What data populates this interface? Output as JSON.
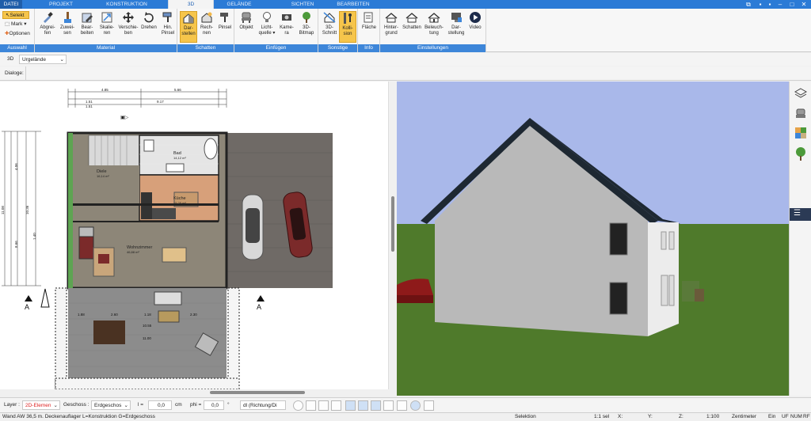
{
  "menu": {
    "tabs": [
      {
        "label": "DATEI"
      },
      {
        "label": "PROJEKT"
      },
      {
        "label": "KONSTRUKTION"
      },
      {
        "label": "3D"
      },
      {
        "label": "GELÄNDE"
      },
      {
        "label": "SICHTEN"
      },
      {
        "label": "BEARBEITEN"
      }
    ]
  },
  "ribbon": {
    "auswahl": {
      "title": "Auswahl",
      "selekt": "Selekt",
      "mark": "Mark",
      "optionen": "Optionen"
    },
    "material": {
      "title": "Material",
      "buttons": [
        {
          "l1": "Abgrei-",
          "l2": "fen"
        },
        {
          "l1": "Zuwei-",
          "l2": "sen"
        },
        {
          "l1": "Bear-",
          "l2": "beiten"
        },
        {
          "l1": "Skalie-",
          "l2": "ren"
        },
        {
          "l1": "Verschie-",
          "l2": "ben"
        },
        {
          "l1": "Drehen",
          "l2": ""
        },
        {
          "l1": "Hin.",
          "l2": "Pinsel"
        }
      ]
    },
    "schatten": {
      "title": "Schatten",
      "buttons": [
        {
          "l1": "Dar-",
          "l2": "stellen"
        },
        {
          "l1": "Rech-",
          "l2": "nen"
        },
        {
          "l1": "Pinsel",
          "l2": ""
        }
      ]
    },
    "einfuegen": {
      "title": "Einfügen",
      "buttons": [
        {
          "l1": "Objekt",
          "l2": ""
        },
        {
          "l1": "Licht-",
          "l2": "quelle ▾"
        },
        {
          "l1": "Kame-",
          "l2": "ra"
        },
        {
          "l1": "3D-",
          "l2": "Bitmap"
        }
      ]
    },
    "sonstige": {
      "title": "Sonstige",
      "buttons": [
        {
          "l1": "3D-",
          "l2": "Schnitt"
        },
        {
          "l1": "Kolli-",
          "l2": "sion"
        }
      ]
    },
    "info": {
      "title": "Info",
      "buttons": [
        {
          "l1": "Fläche",
          "l2": ""
        }
      ]
    },
    "einstellungen": {
      "title": "Einstellungen",
      "buttons": [
        {
          "l1": "Hinter-",
          "l2": "grund"
        },
        {
          "l1": "Schatten",
          "l2": ""
        },
        {
          "l1": "Beleuch-",
          "l2": "tung"
        },
        {
          "l1": "Dar-",
          "l2": "stellung"
        },
        {
          "l1": "Video",
          "l2": ""
        }
      ]
    }
  },
  "viewbar": {
    "mode": "3D",
    "terrain": "Urgelände"
  },
  "dialog": {
    "label": "Dialoge:"
  },
  "plan": {
    "rooms": [
      {
        "name": "Bad",
        "area": "14,12 m²"
      },
      {
        "name": "Diele",
        "area": "16,14 m²"
      },
      {
        "name": "Küche",
        "area": "15,25 m²"
      },
      {
        "name": "Wohnzimmer",
        "area": "46,88 m²"
      }
    ],
    "dims_top": [
      "4.85",
      "5.66",
      "1.51",
      "9.17",
      "1.51"
    ],
    "dims_left": [
      "11.08",
      "10.36",
      "8.66",
      "4.06",
      "1.40"
    ],
    "dims_terrace": [
      "1.88",
      "2.60",
      "1.18",
      "2.30",
      "10.55",
      "11.00"
    ],
    "section_marks": [
      "A",
      "A"
    ]
  },
  "bottombar": {
    "layer_label": "Layer :",
    "layer_value": "2D-Elemen",
    "geschoss_label": "Geschoss :",
    "geschoss_value": "Erdgeschos",
    "l_label": "l =",
    "l_value": "0,0",
    "l_unit": "cm",
    "phi_label": "phi =",
    "phi_value": "0,0",
    "phi_unit": "°",
    "direction": "dl (Richtung/Di"
  },
  "status": {
    "info": "Wand AW 36,5 m. Deckenauflager L=Konstruktion G=Erdgeschoss",
    "mode": "Selektion",
    "count": "1:1 sel",
    "x": "X:",
    "y": "Y:",
    "z": "Z:",
    "scale": "1:100",
    "unit": "Zentimeter",
    "ein": "Ein",
    "uf": "UF",
    "num": "NUM",
    "rf": "RF"
  },
  "colors": {
    "accent": "#3d86d9",
    "menu": "#2b7bd6",
    "selected": "#f6c54b",
    "sky": "#a9b8ea",
    "grass": "#4f7a2b"
  }
}
